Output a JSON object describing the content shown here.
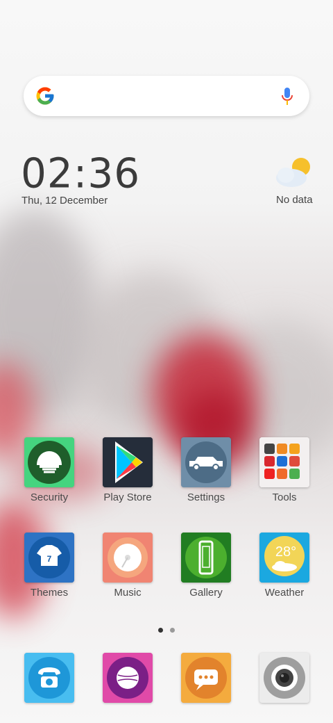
{
  "search": {
    "google_logo": "google-g-icon",
    "mic": "mic-icon"
  },
  "clock": {
    "time": "02:36",
    "date": "Thu, 12 December"
  },
  "weather": {
    "status": "No data",
    "icon": "partly-cloudy-icon"
  },
  "apps": [
    {
      "label": "Security",
      "icon": "helmet-icon"
    },
    {
      "label": "Play Store",
      "icon": "play-store-icon"
    },
    {
      "label": "Settings",
      "icon": "jeep-icon"
    },
    {
      "label": "Tools",
      "icon": "folder-icon"
    },
    {
      "label": "Themes",
      "icon": "jersey-icon",
      "jersey_number": "7"
    },
    {
      "label": "Music",
      "icon": "disc-icon"
    },
    {
      "label": "Gallery",
      "icon": "phone-device-icon"
    },
    {
      "label": "Weather",
      "icon": "weather-sun-icon",
      "temp": "28°"
    }
  ],
  "page_indicator": {
    "count": 2,
    "active": 0
  },
  "dock": [
    {
      "name": "phone",
      "icon": "telephone-icon"
    },
    {
      "name": "cricket",
      "icon": "cricket-ball-icon"
    },
    {
      "name": "messages",
      "icon": "message-icon"
    },
    {
      "name": "camera",
      "icon": "camera-icon"
    }
  ],
  "colors": {
    "accent_green": "#2e7d32",
    "blossom_red": "#c62839"
  }
}
